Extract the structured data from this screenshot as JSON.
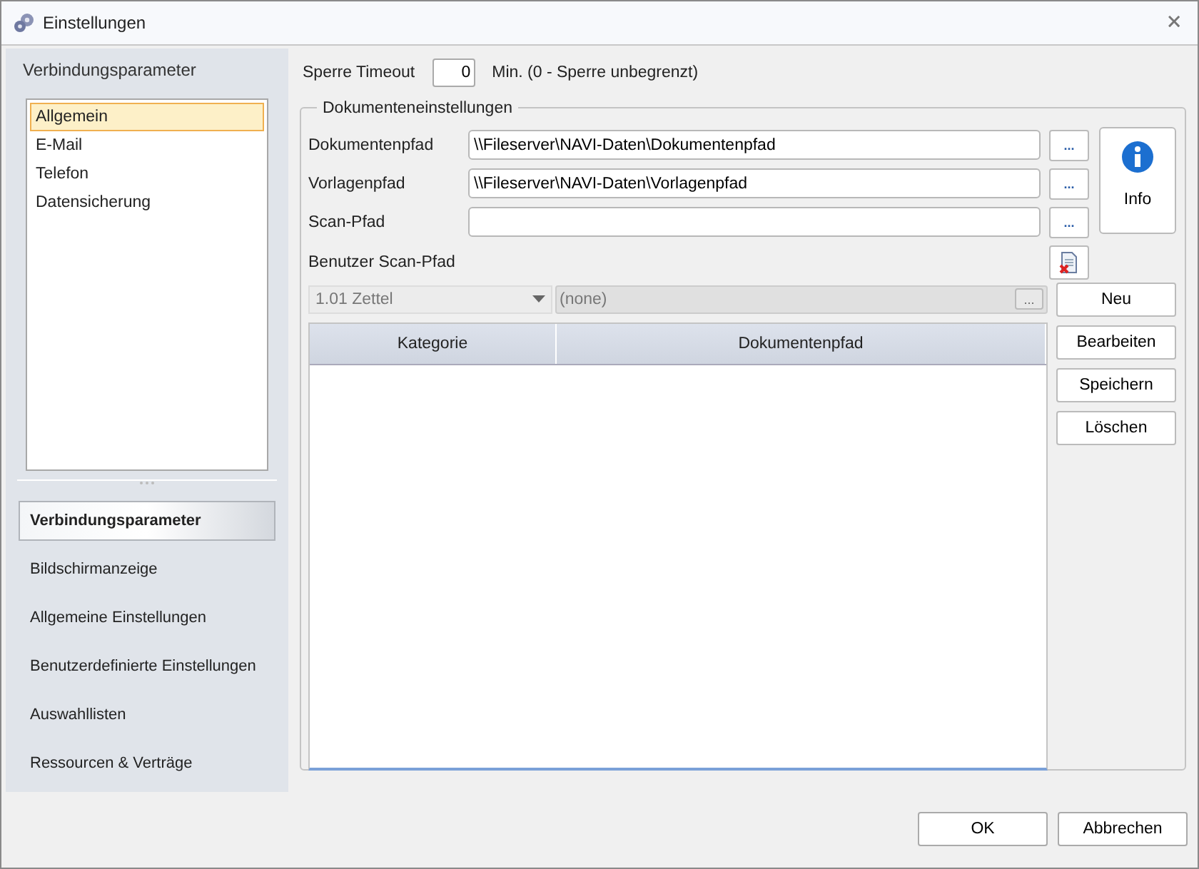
{
  "window": {
    "title": "Einstellungen",
    "close": "🗙"
  },
  "sidebar": {
    "heading": "Verbindungsparameter",
    "list": [
      {
        "label": "Allgemein",
        "selected": true
      },
      {
        "label": "E-Mail",
        "selected": false
      },
      {
        "label": "Telefon",
        "selected": false
      },
      {
        "label": "Datensicherung",
        "selected": false
      }
    ],
    "nav": [
      {
        "label": "Verbindungsparameter",
        "selected": true
      },
      {
        "label": "Bildschirmanzeige",
        "selected": false
      },
      {
        "label": "Allgemeine Einstellungen",
        "selected": false
      },
      {
        "label": "Benutzerdefinierte Einstellungen",
        "selected": false
      },
      {
        "label": "Auswahllisten",
        "selected": false
      },
      {
        "label": "Ressourcen & Verträge",
        "selected": false
      }
    ]
  },
  "timeout": {
    "label": "Sperre Timeout",
    "value": "0",
    "hint": "Min. (0 - Sperre unbegrenzt)"
  },
  "group": {
    "title": "Dokumenteneinstellungen",
    "fields": [
      {
        "label": "Dokumentenpfad",
        "value": "\\\\Fileserver\\NAVI-Daten\\Dokumentenpfad",
        "browse": "..."
      },
      {
        "label": "Vorlagenpfad",
        "value": "\\\\Fileserver\\NAVI-Daten\\Vorlagenpfad",
        "browse": "..."
      },
      {
        "label": "Scan-Pfad",
        "browse": "..."
      }
    ],
    "user_scan_label": "Benutzer Scan-Pfad",
    "info_button": "Info",
    "category_combo": {
      "value": "1.01 Zettel",
      "disabled": true
    },
    "path_field": {
      "value": "(none)",
      "browse": "...",
      "disabled": true
    },
    "table": {
      "columns": [
        "Kategorie",
        "Dokumentenpfad"
      ]
    },
    "buttons": [
      "Neu",
      "Bearbeiten",
      "Speichern",
      "Löschen"
    ]
  },
  "footer": {
    "buttons": [
      "OK",
      "Abbrechen"
    ]
  }
}
